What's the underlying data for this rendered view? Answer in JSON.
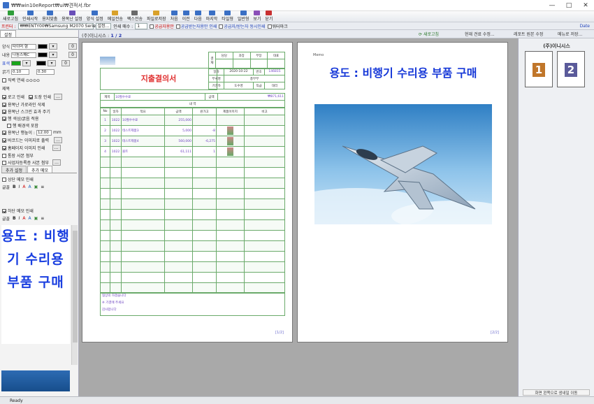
{
  "window": {
    "title": "₩₩win10eReport₩ui₩견적서.fbr",
    "min": "—",
    "max": "□",
    "close": "✕"
  },
  "menu": [
    {
      "label": "새로고침",
      "color": "#2e9e3a"
    },
    {
      "label": "인쇄시작",
      "color": "#3a6fc4"
    },
    {
      "label": "용지맞춤",
      "color": "#3a6fc4"
    },
    {
      "label": "용목난 설정",
      "color": "#6a4fb8"
    },
    {
      "label": "양식 설정",
      "color": "#3a6fc4"
    },
    {
      "label": "메일전송",
      "color": "#d9a12a"
    },
    {
      "label": "팩스전송",
      "color": "#6a6a6a"
    },
    {
      "label": "파일로저장",
      "color": "#d9a12a"
    },
    {
      "label": "처음",
      "color": "#3a6fc4"
    },
    {
      "label": "이전",
      "color": "#3a6fc4"
    },
    {
      "label": "다음",
      "color": "#3a6fc4"
    },
    {
      "label": "마지막",
      "color": "#3a6fc4"
    },
    {
      "label": "타일형",
      "color": "#3a6fc4"
    },
    {
      "label": "일반형",
      "color": "#3a6fc4"
    },
    {
      "label": "보기",
      "color": "#8a4fb8"
    },
    {
      "label": "닫기",
      "color": "#c83030"
    }
  ],
  "toolbar": {
    "printer_label": "프린터 :",
    "printer": "₩₩ENTY00₩Samsung M2070 Series",
    "setup": "설정...",
    "copies_label": "인쇄 매수 :",
    "copies": "1",
    "opt1": "공급자용만",
    "opt2": "공급받는자용만 인쇄",
    "opt3": "공급자/받는자 동시인쇄",
    "opt4": "워터마크",
    "date": "Date"
  },
  "left": {
    "tab_settings": "설정",
    "style_label": "양식",
    "style_value": "타이머 형",
    "content_label": "내용",
    "content_value": "나눔스퀘C",
    "border_label": "표색",
    "line_label": "굵기",
    "line_a": "0.10",
    "line_b": "0.30",
    "chk_bold_line": "직벽 연쇄 ⊙⊙⊙⊙",
    "title_label": "제목",
    "logo": "로고 인쇄",
    "stamp": "도장 인쇄",
    "colgrid": "용목난 가로라인 삭제",
    "colscreen": "용목난 스크린 효과 주기",
    "colorapply": "행 색상/굵음 적용",
    "rowbg": "행 배경색 포함",
    "rowheight": "용목난 행높이 :",
    "rowheight_val": "12.00",
    "rowheight_unit": "mm",
    "barcode": "바코드는 이미지로 출력",
    "homepage": "홈페이지 이미지 인쇄",
    "bank": "통장 사본 첨부",
    "bizreg": "사업자등록증 사본 첨부",
    "tab_extra": "추가 설정",
    "tab_memo": "추가 메모",
    "top_memo": "상단 메모 인쇄",
    "bottom_memo": "하단 메모 인쇄",
    "fmt_label": "글꼴",
    "note": "용도 : 비행기 수리용 부품 구매"
  },
  "docbar": {
    "company": "(주)이니시스 :",
    "page": "1 / 2",
    "btn_refresh": "새로고침",
    "btn_edit": "현재 견료 수정...",
    "btn_report": "레포트 원본 수정",
    "btn_save": "메뉴로 저장..."
  },
  "page1": {
    "title": "지출결의서",
    "approval_headers": [
      "담당",
      "과장",
      "부장",
      "대표"
    ],
    "approval_first": "결재",
    "date_label": "일자",
    "date": "2020-10-22",
    "docno_label": "번호",
    "docno": "146815",
    "dept_label": "부서명",
    "dept": "총무부",
    "drafter_label": "기안자",
    "drafter": "도수영",
    "pos_label": "직급",
    "pos": "대리",
    "subject_label": "제목",
    "subject": "10월수수료",
    "amount_label": "금액",
    "amount": "₩871,611",
    "detail_head": "내  역",
    "col_headers": [
      "No",
      "일자",
      "적요",
      "금액",
      "원가고",
      "제품이미지",
      "비고"
    ],
    "rows": [
      {
        "no": "1",
        "date": "1022",
        "desc": "10월수수료",
        "amt": "255,000",
        "cost": "",
        "img": ""
      },
      {
        "no": "2",
        "date": "1022",
        "desc": "테스트제품3",
        "amt": "5,000",
        "cost": "-8",
        "img": "y"
      },
      {
        "no": "3",
        "date": "1022",
        "desc": "테스트제품4",
        "amt": "560,000",
        "cost": "-6,275",
        "img": "y"
      },
      {
        "no": "4",
        "date": "1022",
        "desc": "볼트",
        "amt": "61,111",
        "cost": "1",
        "img": "y"
      }
    ],
    "foot1": "협상의 하겠습니다",
    "foot2": "※ 기결에 주세요",
    "foot3": "감사합니다",
    "num": "[1/2]"
  },
  "page2": {
    "memo": "Memo",
    "title": "용도 : 비행기 수리용 부품 구매",
    "num": "[2/2]"
  },
  "right": {
    "company": "(주)이니시스",
    "thumb1": "1",
    "thumb2": "2",
    "bottom_btn": "화면 왼쪽으로 생내일 이동"
  },
  "status": {
    "text": "Ready"
  }
}
